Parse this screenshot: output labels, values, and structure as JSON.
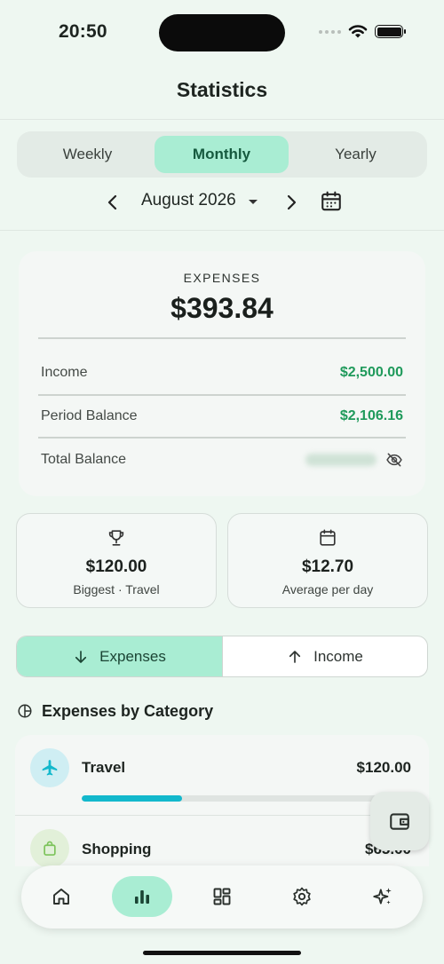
{
  "status_bar": {
    "time": "20:50"
  },
  "header": {
    "title": "Statistics"
  },
  "period_tabs": [
    {
      "label": "Weekly",
      "active": false
    },
    {
      "label": "Monthly",
      "active": true
    },
    {
      "label": "Yearly",
      "active": false
    }
  ],
  "period_nav": {
    "label": "August 2026",
    "prev_icon": "chevron-left-icon",
    "next_icon": "chevron-right-icon",
    "calendar_icon": "calendar-icon"
  },
  "summary": {
    "heading": "EXPENSES",
    "amount": "$393.84",
    "rows": [
      {
        "label": "Income",
        "value": "$2,500.00"
      },
      {
        "label": "Period Balance",
        "value": "$2,106.16"
      },
      {
        "label": "Total Balance",
        "value_hidden": true
      }
    ]
  },
  "stat_cards": [
    {
      "icon": "trophy-icon",
      "amount": "$120.00",
      "caption": "Biggest · Travel"
    },
    {
      "icon": "calendar-icon",
      "amount": "$12.70",
      "caption": "Average per day"
    }
  ],
  "type_toggle": [
    {
      "label": "Expenses",
      "icon": "arrow-down-icon",
      "active": true
    },
    {
      "label": "Income",
      "icon": "arrow-up-icon",
      "active": false
    }
  ],
  "category_section": {
    "title": "Expenses by Category",
    "icon": "pie-chart-icon"
  },
  "categories": [
    {
      "name": "Travel",
      "amount": "$120.00",
      "icon": "airplane-icon",
      "color": "#12b8cc",
      "share": 0.305
    },
    {
      "name": "Shopping",
      "amount": "$65.00",
      "icon": "shopping-bag-icon",
      "color": "#7cc35a"
    }
  ],
  "bottom_nav": [
    {
      "icon": "home-icon",
      "active": false
    },
    {
      "icon": "bar-chart-icon",
      "active": true
    },
    {
      "icon": "dashboard-icon",
      "active": false
    },
    {
      "icon": "gear-icon",
      "active": false
    },
    {
      "icon": "sparkles-icon",
      "active": false
    }
  ],
  "colors": {
    "accent": "#a9edd3",
    "positive": "#1f9a5b",
    "travel": "#12b8cc"
  }
}
